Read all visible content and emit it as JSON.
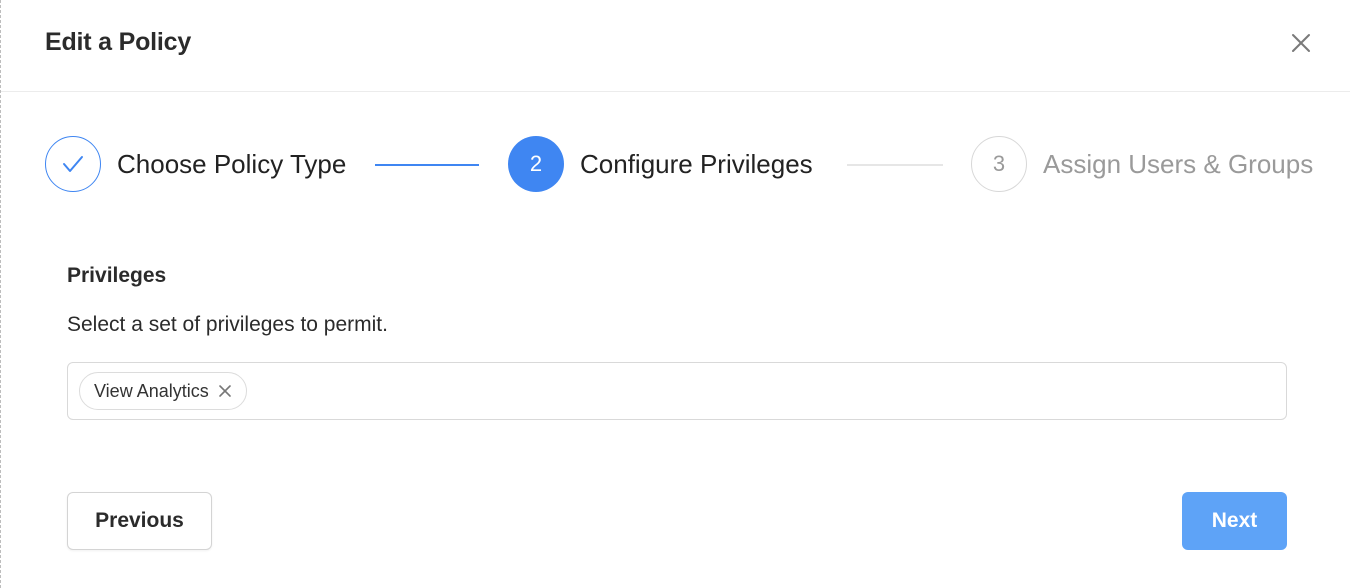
{
  "modal": {
    "title": "Edit a Policy"
  },
  "stepper": {
    "steps": [
      {
        "label": "Choose Policy Type",
        "status": "completed",
        "marker": ""
      },
      {
        "label": "Configure Privileges",
        "status": "active",
        "marker": "2"
      },
      {
        "label": "Assign Users & Groups",
        "status": "pending",
        "marker": "3"
      }
    ]
  },
  "privileges": {
    "title": "Privileges",
    "description": "Select a set of privileges to permit.",
    "selected": [
      {
        "label": "View Analytics"
      }
    ]
  },
  "footer": {
    "previous_label": "Previous",
    "next_label": "Next"
  },
  "colors": {
    "accent": "#3f86f2",
    "next_button": "#5ea3f7",
    "pending": "#9a9a9a"
  },
  "icons": {
    "close": "close-icon",
    "completed_step": "checkmark-icon",
    "chip_remove": "close-icon"
  }
}
